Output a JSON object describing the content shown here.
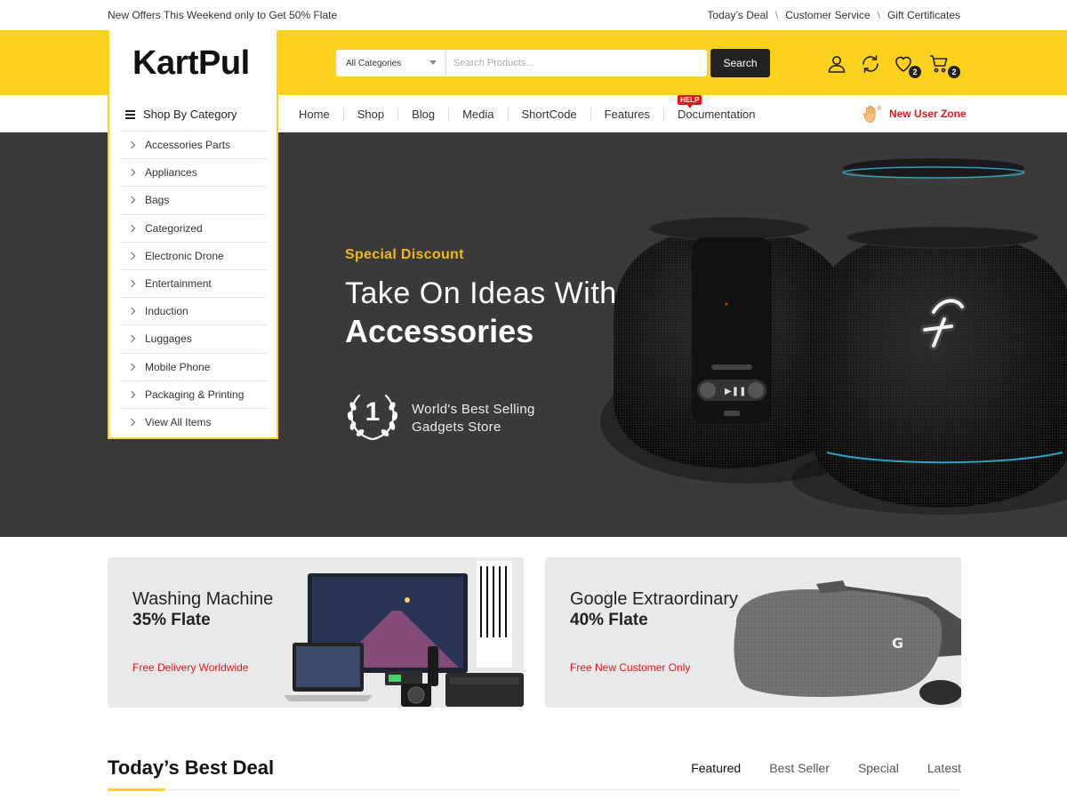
{
  "topbar": {
    "promo": "New Offers This Weekend only to Get 50% Flate",
    "links": [
      "Today’s Deal",
      "Customer Service",
      "Gift Certificates"
    ],
    "separator": "\\"
  },
  "header": {
    "logo": "KartPul",
    "search": {
      "category": "All Categories",
      "placeholder": "Search Products...",
      "button": "Search"
    },
    "icons": [
      "user-icon",
      "refresh-icon",
      "heart-icon",
      "cart-icon"
    ],
    "wishlist_count": "2",
    "cart_count": "2",
    "accent_color": "#fcd21d"
  },
  "nav": {
    "items": [
      "Home",
      "Shop",
      "Blog",
      "Media",
      "ShortCode",
      "Features",
      "Documentation"
    ],
    "help_tag": "HELP",
    "new_user": "New User Zone"
  },
  "categories": {
    "title": "Shop By Category",
    "items": [
      "Accessories Parts",
      "Appliances",
      "Bags",
      "Categorized",
      "Electronic Drone",
      "Entertainment",
      "Induction",
      "Luggages",
      "Mobile Phone",
      "Packaging & Printing",
      "View All Items"
    ]
  },
  "hero": {
    "kicker": "Special Discount",
    "line1": "Take On Ideas With",
    "line2": "Accessories",
    "award_number": "1",
    "award_text_1": "World's Best Selling",
    "award_text_2": "Gadgets Store"
  },
  "banners": [
    {
      "title": "Washing Machine",
      "offer": "35% Flate",
      "note": "Free Delivery Worldwide"
    },
    {
      "title": "Google Extraordinary",
      "offer": "40% Flate",
      "note": "Free New Customer Only"
    }
  ],
  "deals": {
    "title": "Today’s Best Deal",
    "tabs": [
      "Featured",
      "Best Seller",
      "Special",
      "Latest"
    ]
  }
}
